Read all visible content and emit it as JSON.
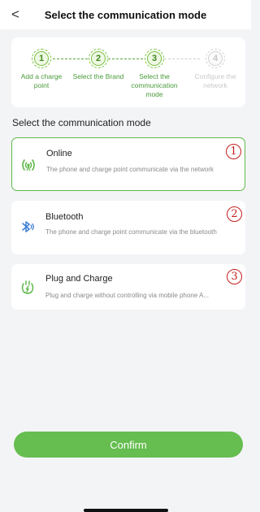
{
  "header": {
    "back_icon": "chevron-left-icon",
    "back_glyph": "<",
    "title": "Select the communication mode"
  },
  "steps": [
    {
      "number": "1",
      "label": "Add a charge point",
      "state": "done"
    },
    {
      "number": "2",
      "label": "Select the Brand",
      "state": "done"
    },
    {
      "number": "3",
      "label": "Select the communication mode",
      "state": "current"
    },
    {
      "number": "4",
      "label": "Configure the network",
      "state": "inactive"
    }
  ],
  "section_title": "Select the communication mode",
  "options": [
    {
      "name": "Online",
      "description": "The phone and charge point communicate via the network",
      "icon": "wireless-signal-icon",
      "badge": "1",
      "selected": true
    },
    {
      "name": "Bluetooth",
      "description": "The phone and charge point communicate via the bluetooth",
      "icon": "bluetooth-icon",
      "badge": "2",
      "selected": false
    },
    {
      "name": "Plug and Charge",
      "description": "Plug and charge without controlling via mobile phone A...",
      "icon": "plug-charge-icon",
      "badge": "3",
      "selected": false
    }
  ],
  "confirm_label": "Confirm",
  "colors": {
    "accent": "#66bd50",
    "badge": "#c41e1e",
    "inactive": "#cfcfcf"
  }
}
